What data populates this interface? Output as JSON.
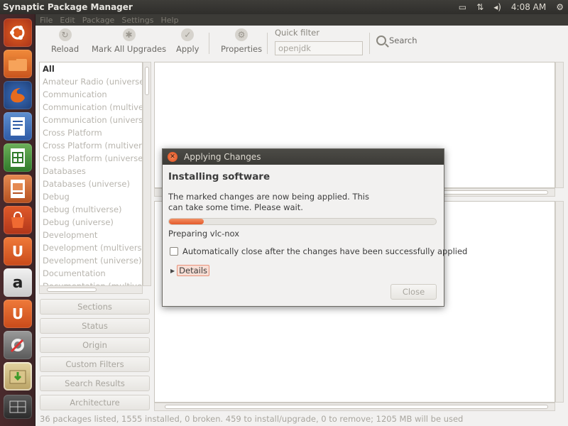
{
  "window": {
    "title": "Synaptic Package Manager"
  },
  "top_panel": {
    "time": "4:08 AM",
    "icons": [
      "battery-icon",
      "network-icon",
      "volume-icon",
      "power-icon"
    ]
  },
  "menu": [
    "File",
    "Edit",
    "Package",
    "Settings",
    "Help"
  ],
  "toolbar": {
    "reload": "Reload",
    "mark_all_upgrades": "Mark All Upgrades",
    "apply": "Apply",
    "properties": "Properties",
    "quick_filter_label": "Quick filter",
    "quick_filter_value": "openjdk",
    "search": "Search"
  },
  "categories": [
    "All",
    "Amateur Radio (universe)",
    "Communication",
    "Communication (multiverse)",
    "Communication (universe)",
    "Cross Platform",
    "Cross Platform (multiverse)",
    "Cross Platform (universe)",
    "Databases",
    "Databases (universe)",
    "Debug",
    "Debug (multiverse)",
    "Debug (universe)",
    "Development",
    "Development (multiverse)",
    "Development (universe)",
    "Documentation",
    "Documentation (multiverse)"
  ],
  "side_buttons": {
    "sections": "Sections",
    "status": "Status",
    "origin": "Origin",
    "custom_filters": "Custom Filters",
    "search_results": "Search Results",
    "architecture": "Architecture"
  },
  "status_bar": "36 packages listed, 1555 installed, 0 broken. 459 to install/upgrade, 0 to remove; 1205 MB will be used",
  "dialog": {
    "title": "Applying Changes",
    "heading": "Installing software",
    "message": "The marked changes are now being applied. This can take some time. Please wait.",
    "progress": 0.13,
    "progress_status": "Preparing vlc-nox",
    "auto_close_label": "Automatically close after the changes have been successfully applied",
    "auto_close_checked": false,
    "details_label": "Details",
    "close_label": "Close"
  },
  "colors": {
    "accent": "#e45a2a",
    "launcher_bg": "#4a2a2c",
    "panel_bg": "#3c3b37"
  }
}
